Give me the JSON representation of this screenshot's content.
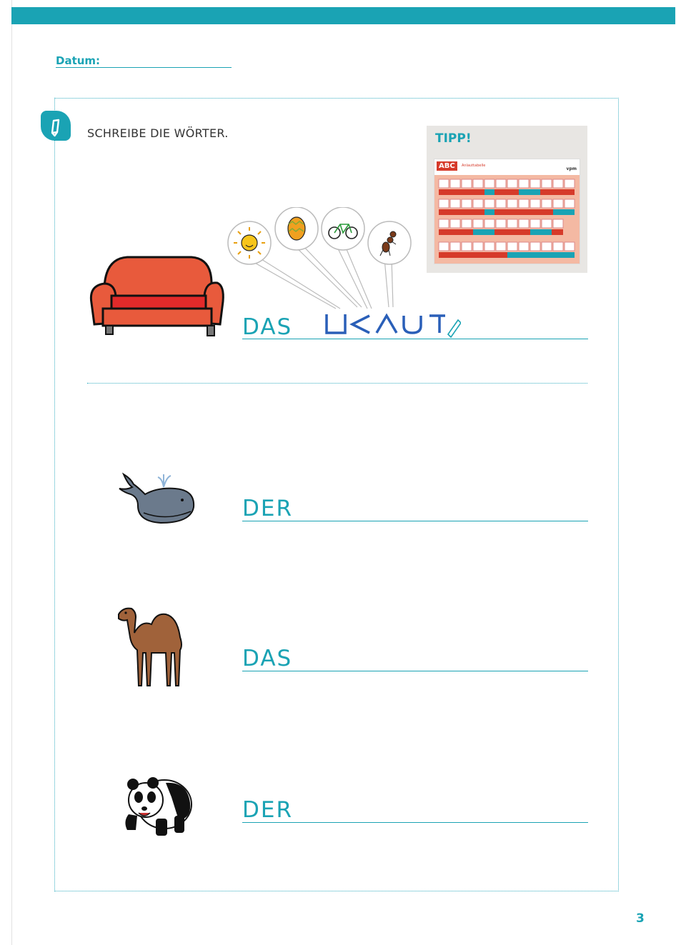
{
  "header": {
    "datum_label": "Datum:"
  },
  "task": {
    "instruction": "SCHREIBE DIE WÖRTER.",
    "icon": "pencil-icon"
  },
  "tip": {
    "label": "TIPP!",
    "chart_title": "ABC",
    "chart_subtitle": "Anlauttabelle",
    "chart_publisher": "vpm"
  },
  "rows": [
    {
      "article": "DAS",
      "picture": "sofa",
      "hint_pictures": [
        "sun",
        "egg",
        "bicycle",
        "ant"
      ]
    },
    {
      "article": "DER",
      "picture": "whale"
    },
    {
      "article": "DAS",
      "picture": "camel"
    },
    {
      "article": "DER",
      "picture": "panda"
    }
  ],
  "footer": {
    "page_number": "3"
  },
  "colors": {
    "accent": "#1aa3b4",
    "sofa": "#e8553a",
    "tip_bg": "#e8e6e3",
    "chart_bg": "#f4b9a3"
  }
}
